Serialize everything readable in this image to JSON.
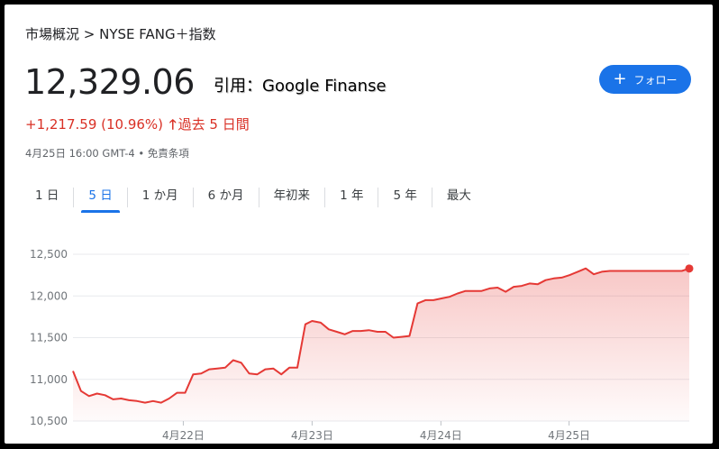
{
  "breadcrumb": "市場概況 > NYSE FANG＋指数",
  "price": "12,329.06",
  "credit": "引用：Google Finanse",
  "follow_button": {
    "icon": "plus-icon",
    "label": "フォロー",
    "color": "#1a73e8"
  },
  "change": {
    "text": "+1,217.59 (10.96%)",
    "arrow": "up-arrow-icon",
    "arrow_glyph": "🡑",
    "period": "過去 5 日間",
    "color": "#d93025"
  },
  "timestamp": "4月25日 16:00 GMT-4 • 免責条項",
  "tabs": [
    {
      "label": "1 日",
      "active": false
    },
    {
      "label": "5 日",
      "active": true
    },
    {
      "label": "1 か月",
      "active": false
    },
    {
      "label": "6 か月",
      "active": false
    },
    {
      "label": "年初来",
      "active": false
    },
    {
      "label": "1 年",
      "active": false
    },
    {
      "label": "5 年",
      "active": false
    },
    {
      "label": "最大",
      "active": false
    }
  ],
  "chart_data": {
    "type": "area",
    "ylim": [
      10500,
      12500
    ],
    "ytick_labels": [
      "12,500",
      "12,000",
      "11,500",
      "11,000",
      "10,500"
    ],
    "ytick_values": [
      12500,
      12000,
      11500,
      11000,
      10500
    ],
    "xlim": [
      0,
      100
    ],
    "xtick_labels": [
      "4月22日",
      "4月23日",
      "4月24日",
      "4月25日"
    ],
    "xtick_values": [
      17.9,
      38.8,
      59.7,
      80.5
    ],
    "line_color": "#e53935",
    "fill_color": "#e53935",
    "grid": true,
    "series": [
      {
        "x": [
          0,
          1.3,
          2.6,
          3.9,
          5.2,
          6.5,
          7.8,
          9.1,
          10.4,
          11.7,
          13.0,
          14.3,
          15.6,
          16.9,
          18.2,
          19.5,
          20.8,
          22.1,
          23.4,
          24.7,
          26.0,
          27.3,
          28.6,
          29.9,
          31.2,
          32.5,
          33.8,
          35.1,
          36.4,
          37.7,
          38.8,
          40.2,
          41.5,
          42.8,
          44.1,
          45.4,
          46.7,
          48.0,
          49.4,
          50.7,
          52.0,
          53.3,
          54.6,
          55.9,
          57.2,
          58.5,
          59.8,
          61.1,
          62.4,
          63.7,
          65.0,
          66.3,
          67.6,
          68.9,
          70.2,
          71.5,
          72.8,
          74.1,
          75.4,
          76.7,
          78.0,
          79.3,
          80.6,
          81.9,
          83.2,
          84.5,
          85.8,
          87.1,
          88.4,
          89.7,
          91.0,
          92.3,
          93.6,
          94.9,
          96.2,
          97.5,
          98.8,
          100
        ],
        "y": [
          11100,
          10860,
          10800,
          10830,
          10810,
          10760,
          10770,
          10750,
          10740,
          10720,
          10740,
          10720,
          10770,
          10840,
          10840,
          11060,
          11070,
          11120,
          11130,
          11140,
          11230,
          11200,
          11070,
          11060,
          11120,
          11130,
          11060,
          11140,
          11140,
          11660,
          11700,
          11680,
          11600,
          11570,
          11540,
          11580,
          11580,
          11590,
          11570,
          11570,
          11500,
          11510,
          11520,
          11910,
          11950,
          11950,
          11970,
          11990,
          12030,
          12060,
          12060,
          12060,
          12090,
          12100,
          12050,
          12110,
          12120,
          12150,
          12140,
          12190,
          12210,
          12220,
          12250,
          12290,
          12330,
          12260,
          12290,
          12300,
          12300,
          12300,
          12300,
          12300,
          12300,
          12300,
          12300,
          12300,
          12300,
          12329
        ]
      }
    ]
  }
}
